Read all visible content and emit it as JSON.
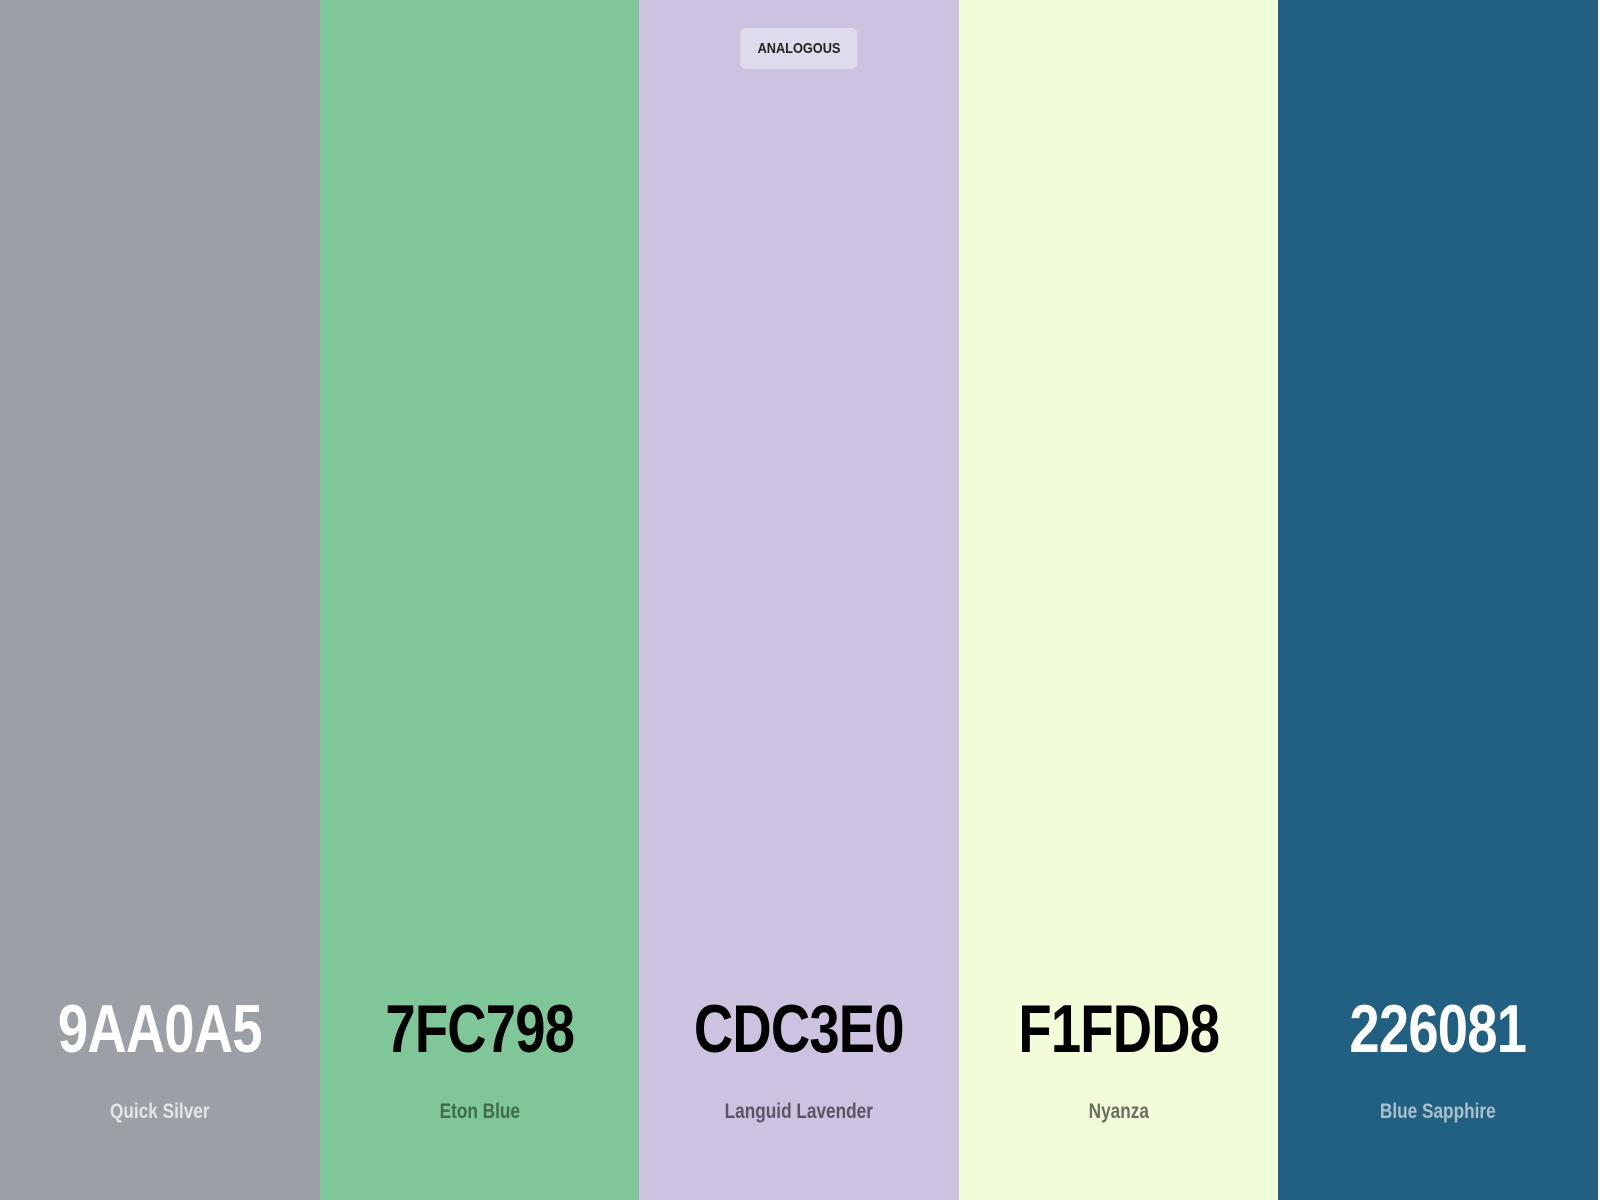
{
  "badge": "ANALOGOUS",
  "colors": [
    {
      "hex": "9AA0A5",
      "name": "Quick Silver",
      "bg": "#9aa0a5",
      "hex_color": "#ffffff",
      "name_color": "#e3e5e7"
    },
    {
      "hex": "7FC798",
      "name": "Eton Blue",
      "bg": "#7fc798",
      "hex_color": "#000000",
      "name_color": "#3f6a4d"
    },
    {
      "hex": "CDC3E0",
      "name": "Languid Lavender",
      "bg": "#cdc3e0",
      "hex_color": "#000000",
      "name_color": "#5a5566"
    },
    {
      "hex": "F1FDD8",
      "name": "Nyanza",
      "bg": "#f1fdd8",
      "hex_color": "#000000",
      "name_color": "#6b6f62"
    },
    {
      "hex": "226081",
      "name": "Blue Sapphire",
      "bg": "#226081",
      "hex_color": "#ffffff",
      "name_color": "#a9c0cf"
    }
  ]
}
